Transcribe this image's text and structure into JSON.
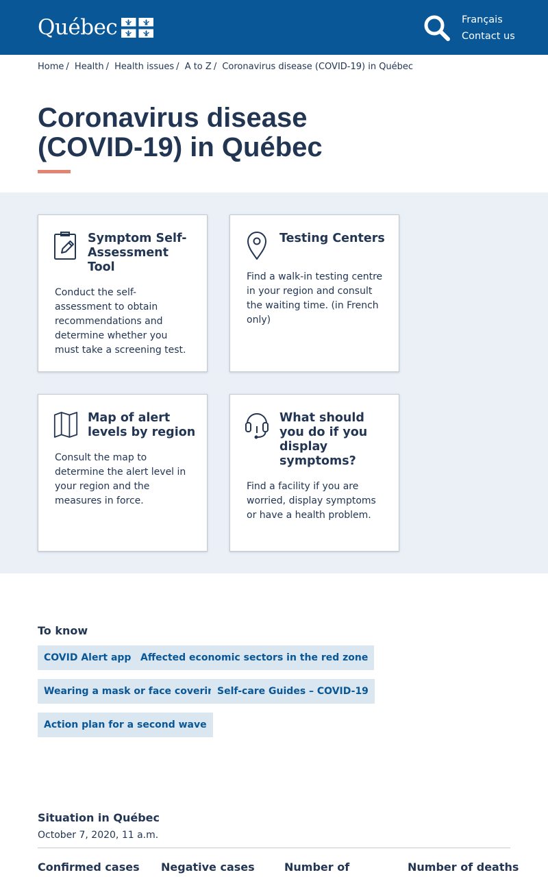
{
  "header": {
    "logo_text": "Québec",
    "search_icon": "search-icon",
    "language_link": "Français",
    "contact_link": "Contact us",
    "background": "#095797"
  },
  "breadcrumb": [
    "Home",
    "Health",
    "Health issues",
    "A to Z",
    "Coronavirus disease (COVID-19) in Québec"
  ],
  "page_title": "Coronavirus disease (COVID-19) in Québec",
  "accent_color": "#e58271",
  "cards": [
    {
      "icon": "clipboard-edit-icon",
      "title": "Symptom Self-Assessment Tool",
      "description": "Conduct the self-assessment to obtain recommendations and determine whether you must take a screening test."
    },
    {
      "icon": "map-pin-icon",
      "title": "Testing Centers",
      "description": "Find a walk-in testing centre in your region and consult the waiting time. (in French only)"
    },
    {
      "icon": "folded-map-icon",
      "title": "Map of alert levels by region",
      "description": "Consult the map to determine the alert level in your region and the measures in force."
    },
    {
      "icon": "headset-icon",
      "title": "What should you do if you display symptoms?",
      "description": "Find a facility if you are worried, display symptoms or have a health problem."
    }
  ],
  "to_know": {
    "title": "To know",
    "tags": [
      "COVID Alert app",
      "Affected economic sectors in the red zone",
      "Wearing a mask or face covering",
      "Self-care Guides – COVID-19",
      "Action plan for a second wave"
    ]
  },
  "situation": {
    "title": "Situation in Québec",
    "date": "October 7, 2020, 11 a.m.",
    "columns": [
      "Confirmed cases",
      "Negative cases",
      "Number of",
      "Number of deaths"
    ]
  }
}
